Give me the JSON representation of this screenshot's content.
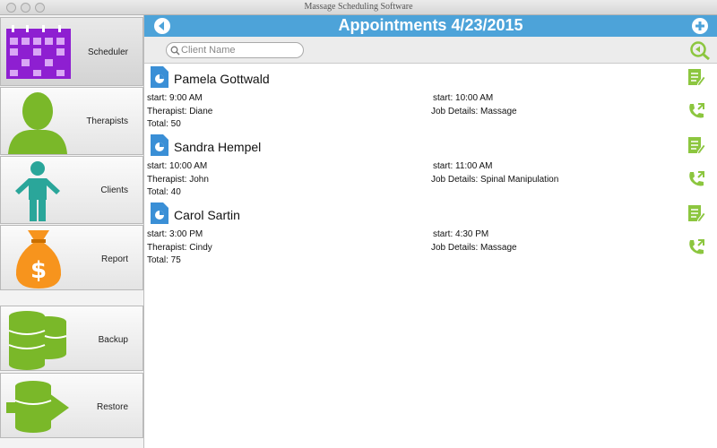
{
  "window": {
    "title": "Massage Scheduling Software"
  },
  "sidebar": {
    "items": [
      {
        "label": "Scheduler",
        "icon": "calendar-icon"
      },
      {
        "label": "Therapists",
        "icon": "person-icon"
      },
      {
        "label": "Clients",
        "icon": "client-figure-icon"
      },
      {
        "label": "Report",
        "icon": "money-bag-icon"
      },
      {
        "label": "Backup",
        "icon": "database-stack-icon"
      },
      {
        "label": "Restore",
        "icon": "database-restore-icon"
      }
    ]
  },
  "header": {
    "title": "Appointments 4/23/2015"
  },
  "search": {
    "placeholder": "Client Name",
    "value": ""
  },
  "appointments": [
    {
      "name": "Pamela Gottwald",
      "start": "start: 9:00 AM",
      "end": "start: 10:00 AM",
      "therapist": "Therapist: Diane",
      "job": "Job Details: Massage",
      "total": "Total: 50"
    },
    {
      "name": "Sandra Hempel",
      "start": "start: 10:00 AM",
      "end": "start: 11:00 AM",
      "therapist": "Therapist: John",
      "job": "Job Details: Spinal Manipulation",
      "total": "Total: 40"
    },
    {
      "name": "Carol Sartin",
      "start": "start: 3:00 PM",
      "end": "start: 4:30 PM",
      "therapist": "Therapist: Cindy",
      "job": "Job Details: Massage",
      "total": "Total: 75"
    }
  ],
  "colors": {
    "header_blue": "#4da3d9",
    "accent_green": "#8cc63f",
    "calendar_purple": "#8e1fd1",
    "person_green": "#7ab829",
    "client_teal": "#2aa69a",
    "report_orange": "#f7941d"
  }
}
